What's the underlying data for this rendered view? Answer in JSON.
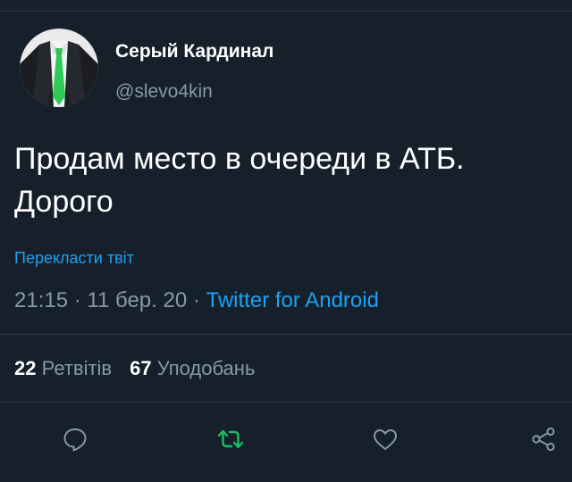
{
  "tweet": {
    "author": {
      "display_name": "Серый Кардинал",
      "handle": "@slevo4kin"
    },
    "text_line1": "Продам место в очереди в АТБ.",
    "text_line2": "Дорого",
    "translate_label": "Перекласти твіт",
    "time": "21:15",
    "date": "11 бер. 20",
    "separator": " · ",
    "source": "Twitter for Android",
    "retweets": {
      "count": "22",
      "label": "Ретвітів"
    },
    "likes": {
      "count": "67",
      "label": "Уподобань"
    }
  },
  "actions": {
    "reply_icon": "speech-bubble-icon",
    "retweet_icon": "retweet-arrows-icon",
    "like_icon": "heart-icon",
    "share_icon": "share-nodes-icon"
  },
  "colors": {
    "background": "#15202b",
    "accent": "#1da1f2",
    "secondary_text": "#8899a6",
    "retweet_active": "#17bf63"
  }
}
